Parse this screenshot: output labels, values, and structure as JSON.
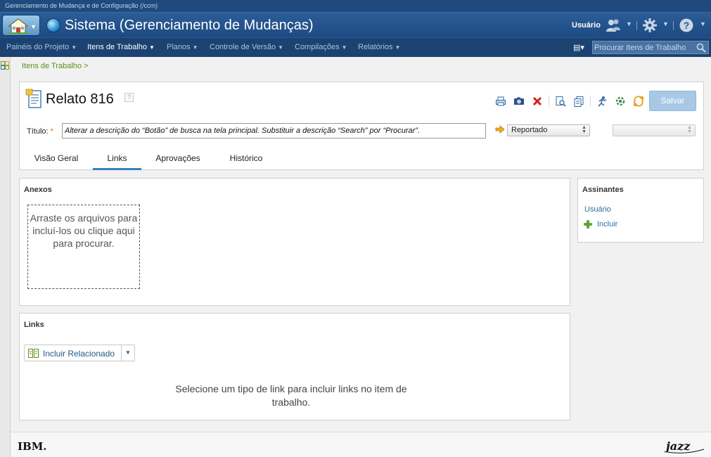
{
  "app": {
    "window_title": "Gerenciamento de Mudança e de Configuração (/ccm)",
    "system_title": "Sistema (Gerenciamento de Mudanças)",
    "user_label": "Usuário"
  },
  "nav": {
    "items": [
      {
        "label": "Painéis do Projeto"
      },
      {
        "label": "Itens de Trabalho"
      },
      {
        "label": "Planos"
      },
      {
        "label": "Controle de Versão"
      },
      {
        "label": "Compilações"
      },
      {
        "label": "Relatórios"
      }
    ],
    "search_placeholder": "Procurar Itens de Trabalho"
  },
  "breadcrumb": "Itens de Trabalho >",
  "work_item": {
    "title": "Relato 816",
    "help": "?",
    "save_label": "Salvar",
    "title_label": "Título:",
    "required_mark": "*",
    "title_value": "Alterar a descrição do “Botão” de busca na tela principal. Substituir a descrição “Search” por “Procurar”.",
    "status": "Reportado"
  },
  "tabs": [
    {
      "label": "Visão Geral"
    },
    {
      "label": "Links"
    },
    {
      "label": "Aprovações"
    },
    {
      "label": "Histórico"
    }
  ],
  "attachments": {
    "title": "Anexos",
    "drop_text": "Arraste os arquivos para incluí-los ou clique aqui para procurar."
  },
  "subscribers": {
    "title": "Assinantes",
    "user": "Usuário",
    "add": "Incluir"
  },
  "links": {
    "title": "Links",
    "add_related": "Incluir Relacionado",
    "empty_text": "Selecione um tipo de link para incluir links no item de trabalho."
  },
  "footer": {
    "ibm": "IBM.",
    "jazz": "jazz"
  },
  "colors": {
    "banner": "#1d4a82",
    "navbar": "#1b4270",
    "accent": "#3b82b8",
    "save_disabled": "#a8c8e6",
    "breadcrumb": "#5a8f1a"
  }
}
